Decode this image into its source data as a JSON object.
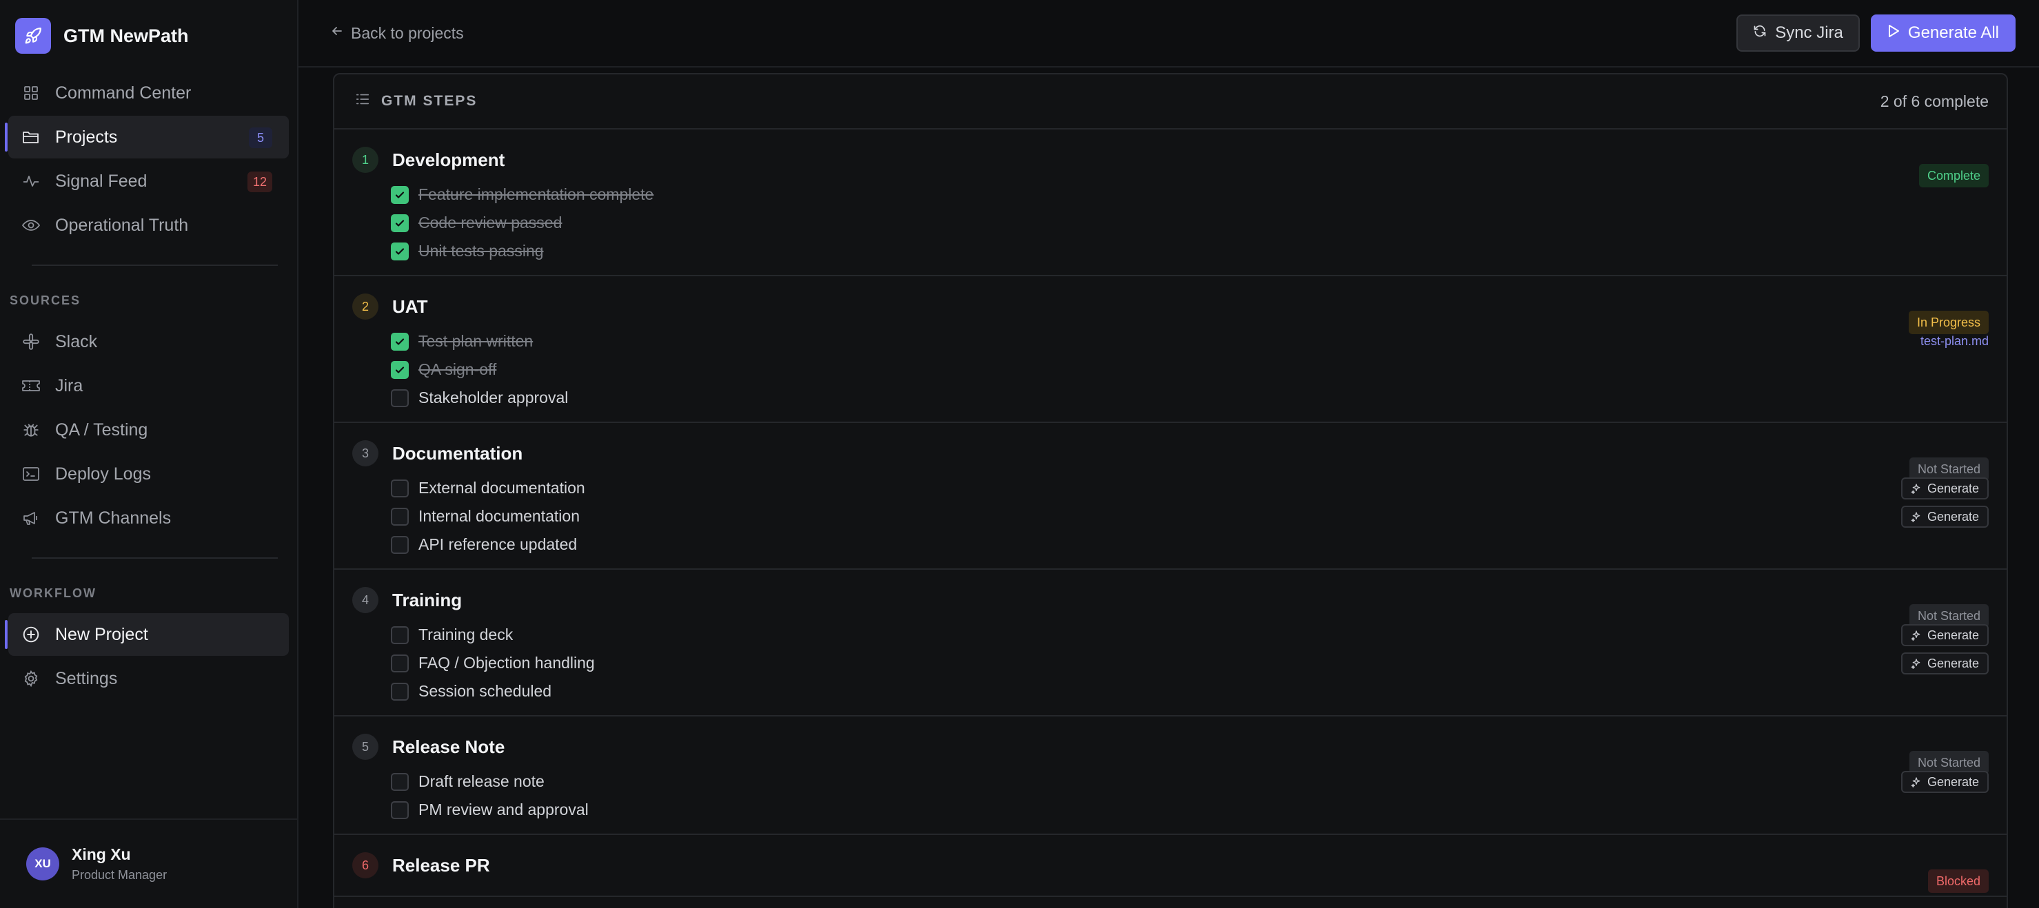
{
  "brand": {
    "name": "GTM NewPath"
  },
  "nav": {
    "main": [
      {
        "label": "Command Center",
        "icon": "grid-icon",
        "active": false
      },
      {
        "label": "Projects",
        "icon": "folder-icon",
        "active": true,
        "badge": "5"
      },
      {
        "label": "Signal Feed",
        "icon": "activity-icon",
        "active": false,
        "badge": "12"
      },
      {
        "label": "Operational Truth",
        "icon": "eye-icon",
        "active": false
      }
    ],
    "sources_label": "SOURCES",
    "sources": [
      {
        "label": "Slack",
        "icon": "slack-icon"
      },
      {
        "label": "Jira",
        "icon": "ticket-icon"
      },
      {
        "label": "QA / Testing",
        "icon": "bug-icon"
      },
      {
        "label": "Deploy Logs",
        "icon": "terminal-icon"
      },
      {
        "label": "GTM Channels",
        "icon": "megaphone-icon"
      }
    ],
    "workflow_label": "WORKFLOW",
    "workflow": [
      {
        "label": "New Project",
        "icon": "plus-circle-icon",
        "active": true
      },
      {
        "label": "Settings",
        "icon": "gear-icon",
        "active": false
      }
    ]
  },
  "user": {
    "initials": "XU",
    "name": "Xing Xu",
    "role": "Product Manager"
  },
  "topbar": {
    "back_label": "Back to projects",
    "sync_label": "Sync Jira",
    "generate_all_label": "Generate All"
  },
  "panel": {
    "title": "GTM STEPS",
    "progress": "2 of 6 complete"
  },
  "steps": [
    {
      "num": "1",
      "title": "Development",
      "status": "Complete",
      "tasks": [
        {
          "label": "Feature implementation complete",
          "done": true
        },
        {
          "label": "Code review passed",
          "done": true
        },
        {
          "label": "Unit tests passing",
          "done": true
        }
      ]
    },
    {
      "num": "2",
      "title": "UAT",
      "status": "In Progress",
      "tasks": [
        {
          "label": "Test plan written",
          "done": true,
          "file": "test-plan.md"
        },
        {
          "label": "QA sign-off",
          "done": true
        },
        {
          "label": "Stakeholder approval",
          "done": false
        }
      ]
    },
    {
      "num": "3",
      "title": "Documentation",
      "status": "Not Started",
      "tasks": [
        {
          "label": "External documentation",
          "done": false,
          "action": "Generate"
        },
        {
          "label": "Internal documentation",
          "done": false,
          "action": "Generate"
        },
        {
          "label": "API reference updated",
          "done": false
        }
      ]
    },
    {
      "num": "4",
      "title": "Training",
      "status": "Not Started",
      "tasks": [
        {
          "label": "Training deck",
          "done": false,
          "action": "Generate"
        },
        {
          "label": "FAQ / Objection handling",
          "done": false,
          "action": "Generate"
        },
        {
          "label": "Session scheduled",
          "done": false
        }
      ]
    },
    {
      "num": "5",
      "title": "Release Note",
      "status": "Not Started",
      "tasks": [
        {
          "label": "Draft release note",
          "done": false,
          "action": "Generate"
        },
        {
          "label": "PM review and approval",
          "done": false
        }
      ]
    },
    {
      "num": "6",
      "title": "Release PR",
      "status": "Blocked",
      "tasks": []
    }
  ]
}
